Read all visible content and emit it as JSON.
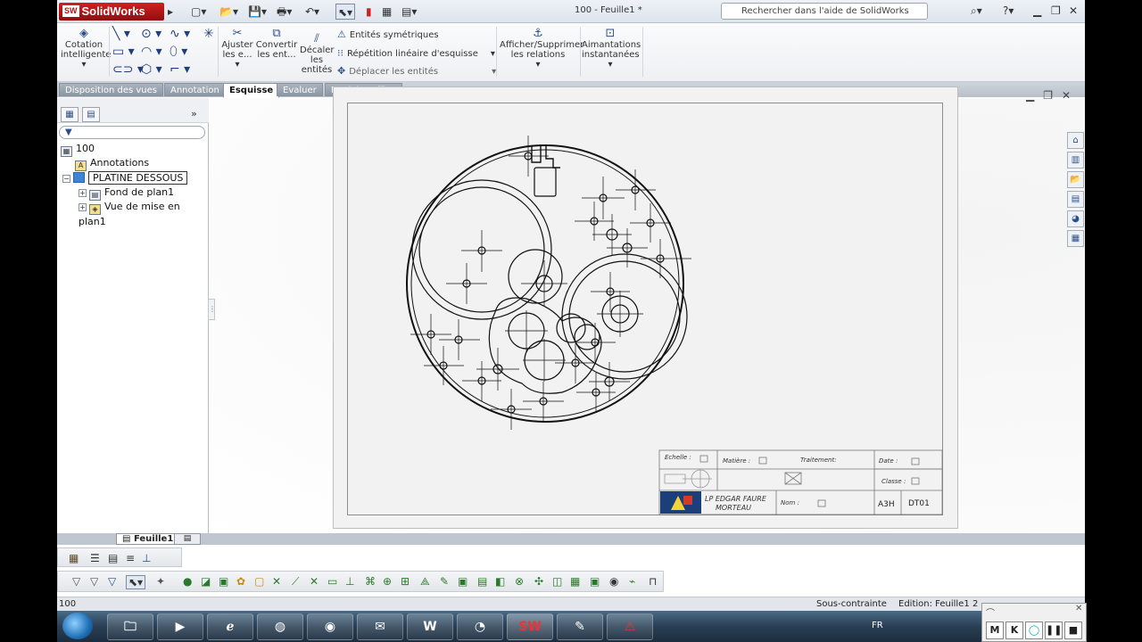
{
  "app": {
    "name": "SolidWorks",
    "logo_badge": "SW",
    "document_title": "100 - Feuille1 *",
    "search_placeholder": "Rechercher dans l'aide de SolidWorks",
    "search_icon": "help-search-icon"
  },
  "ribbon": {
    "cotation_line1": "Cotation",
    "cotation_line2": "intelligente",
    "ajuster_line1": "Ajuster",
    "ajuster_line2": "les e...",
    "convertir_line1": "Convertir",
    "convertir_line2": "les ent...",
    "decaler_line1": "Décaler",
    "decaler_line2": "les",
    "decaler_line3": "entités",
    "entites_symetriques": "Entités symétriques",
    "repetition_lineaire": "Répétition linéaire d'esquisse",
    "deplacer_entites": "Déplacer les entités",
    "afficher_line1": "Afficher/Supprimer",
    "afficher_line2": "les relations",
    "aimantations_line1": "Aimantations",
    "aimantations_line2": "instantanées"
  },
  "tabs": [
    {
      "label": "Disposition des vues",
      "active": false
    },
    {
      "label": "Annotation",
      "active": false
    },
    {
      "label": "Esquisse",
      "active": true
    },
    {
      "label": "Evaluer",
      "active": false
    },
    {
      "label": "Produits Office",
      "active": false
    }
  ],
  "tree": {
    "root": "100",
    "annotations": "Annotations",
    "view": "PLATINE DESSOUS",
    "fond": "Fond de plan1",
    "vue_mise_en_plan": "Vue de mise en plan1"
  },
  "titleblock": {
    "echelle": "Echelle :",
    "matiere": "Matière :",
    "traitement": "Traitement:",
    "date": "Date :",
    "classe": "Classe :",
    "school_line1": "LP EDGAR FAURE",
    "school_line2": "MORTEAU",
    "nom": "Nom :",
    "format": "A3H",
    "code": "DT01"
  },
  "bottom": {
    "sheet_tab": "Feuille1",
    "status_left": "100",
    "status_constraint": "Sous-contrainte",
    "status_edition": "Edition: Feuille1",
    "status_more": "2"
  },
  "taskbar": {
    "lang": "FR",
    "overlay_m": "M",
    "overlay_k": "K"
  },
  "colors": {
    "accent": "#2b4e8a",
    "solidworks_red": "#c01010",
    "active_tab_bg": "#ffffff",
    "taskbar_dark": "#1d2d3f"
  }
}
